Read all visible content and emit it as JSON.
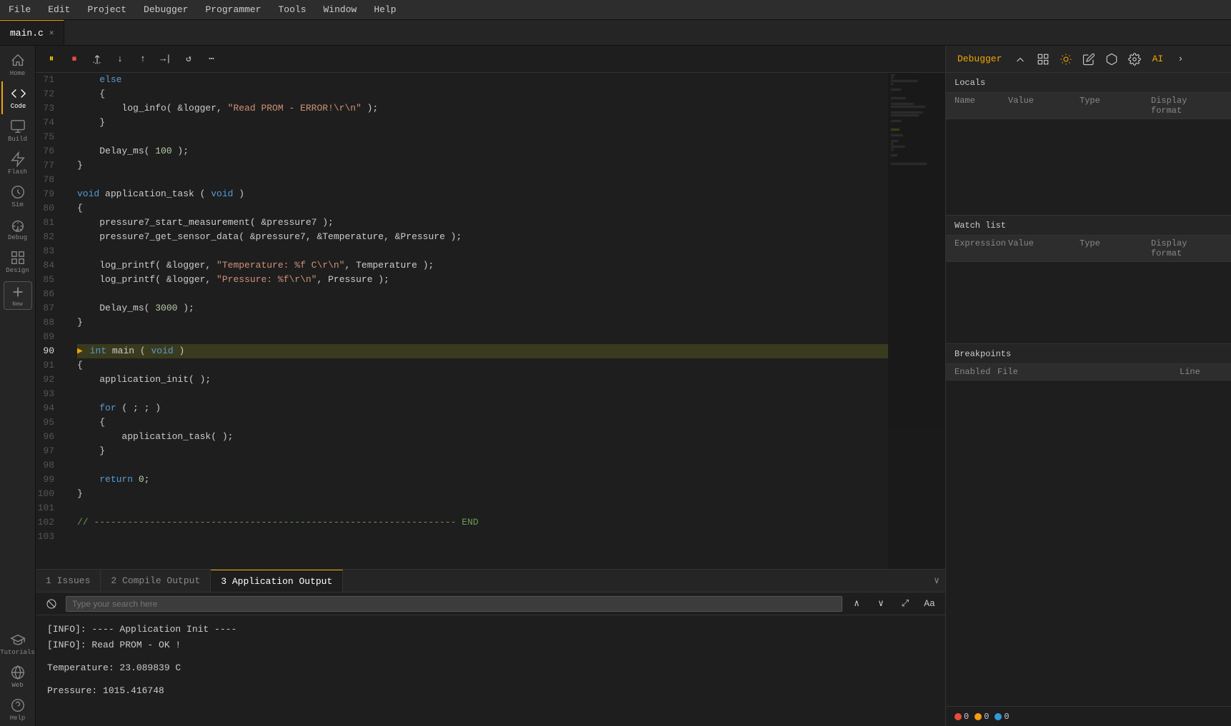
{
  "menu": {
    "items": [
      "File",
      "Edit",
      "Project",
      "Debugger",
      "Programmer",
      "Tools",
      "Window",
      "Help"
    ]
  },
  "tab": {
    "name": "main.c",
    "active": true
  },
  "debug_toolbar": {
    "pause_label": "⏸",
    "stop_label": "⏹",
    "step_over": "↷",
    "step_into": "↓",
    "step_out": "↑",
    "run_to": "→|",
    "restart": "↺",
    "more": "⋯"
  },
  "code_lines": [
    {
      "num": 71,
      "content": "    else",
      "highlight": false
    },
    {
      "num": 72,
      "content": "    {",
      "highlight": false
    },
    {
      "num": 73,
      "content": "        log_info( &logger, \"Read PROM - ERROR!\\r\\n\" );",
      "highlight": false
    },
    {
      "num": 74,
      "content": "    }",
      "highlight": false
    },
    {
      "num": 75,
      "content": "",
      "highlight": false
    },
    {
      "num": 76,
      "content": "    Delay_ms( 100 );",
      "highlight": false
    },
    {
      "num": 77,
      "content": "}",
      "highlight": false
    },
    {
      "num": 78,
      "content": "",
      "highlight": false
    },
    {
      "num": 79,
      "content": "void application_task ( void )",
      "highlight": false
    },
    {
      "num": 80,
      "content": "{",
      "highlight": false
    },
    {
      "num": 81,
      "content": "    pressure7_start_measurement( &pressure7 );",
      "highlight": false
    },
    {
      "num": 82,
      "content": "    pressure7_get_sensor_data( &pressure7, &Temperature, &Pressure );",
      "highlight": false
    },
    {
      "num": 83,
      "content": "",
      "highlight": false
    },
    {
      "num": 84,
      "content": "    log_printf( &logger, \"Temperature: %f C\\r\\n\", Temperature );",
      "highlight": false
    },
    {
      "num": 85,
      "content": "    log_printf( &logger, \"Pressure: %f\\r\\n\", Pressure );",
      "highlight": false
    },
    {
      "num": 86,
      "content": "",
      "highlight": false
    },
    {
      "num": 87,
      "content": "    Delay_ms( 3000 );",
      "highlight": false
    },
    {
      "num": 88,
      "content": "}",
      "highlight": false
    },
    {
      "num": 89,
      "content": "",
      "highlight": false
    },
    {
      "num": 90,
      "content": "int main ( void )",
      "highlight": true,
      "arrow": true
    },
    {
      "num": 91,
      "content": "{",
      "highlight": false
    },
    {
      "num": 92,
      "content": "    application_init( );",
      "highlight": false
    },
    {
      "num": 93,
      "content": "",
      "highlight": false
    },
    {
      "num": 94,
      "content": "    for ( ; ; )",
      "highlight": false
    },
    {
      "num": 95,
      "content": "    {",
      "highlight": false
    },
    {
      "num": 96,
      "content": "        application_task( );",
      "highlight": false
    },
    {
      "num": 97,
      "content": "    }",
      "highlight": false
    },
    {
      "num": 98,
      "content": "",
      "highlight": false
    },
    {
      "num": 99,
      "content": "    return 0;",
      "highlight": false
    },
    {
      "num": 100,
      "content": "}",
      "highlight": false
    },
    {
      "num": 101,
      "content": "",
      "highlight": false
    },
    {
      "num": 102,
      "content": "// ----------------------------------------------------------------- END",
      "highlight": false
    },
    {
      "num": 103,
      "content": "",
      "highlight": false
    }
  ],
  "bottom_panel": {
    "tabs": [
      {
        "label": "1 Issues",
        "id": "issues"
      },
      {
        "label": "2 Compile Output",
        "id": "compile"
      },
      {
        "label": "3 Application Output",
        "id": "appout",
        "active": true
      }
    ],
    "search_placeholder": "Type your search here",
    "output_lines": [
      "[INFO]: ---- Application Init ----",
      "[INFO]: Read PROM - OK !",
      "",
      "Temperature: 23.089839 C",
      "",
      "Pressure: 1015.416748"
    ]
  },
  "right_panel": {
    "debugger_label": "Debugger",
    "sections": {
      "locals": {
        "header": "Locals",
        "columns": [
          "Name",
          "Value",
          "Type",
          "Display format"
        ]
      },
      "watch": {
        "header": "Watch list",
        "columns": [
          "Expression",
          "Value",
          "Type",
          "Display format"
        ]
      },
      "breakpoints": {
        "header": "Breakpoints",
        "columns": [
          "Enabled",
          "File",
          "Line"
        ]
      }
    }
  },
  "sidebar": {
    "items": [
      {
        "label": "Home",
        "icon": "home"
      },
      {
        "label": "Code",
        "icon": "code",
        "active": true
      },
      {
        "label": "Build",
        "icon": "build"
      },
      {
        "label": "Flash",
        "icon": "flash"
      },
      {
        "label": "Sim",
        "icon": "sim"
      },
      {
        "label": "Debug",
        "icon": "debug"
      },
      {
        "label": "Design",
        "icon": "design"
      },
      {
        "label": "New",
        "icon": "new",
        "special": true
      }
    ],
    "bottom_items": [
      {
        "label": "Tutorials",
        "icon": "tutorials"
      },
      {
        "label": "Web",
        "icon": "web"
      },
      {
        "label": "Help",
        "icon": "help"
      }
    ]
  },
  "status_bar": {
    "errors": "0",
    "warnings": "0",
    "info": "0"
  }
}
